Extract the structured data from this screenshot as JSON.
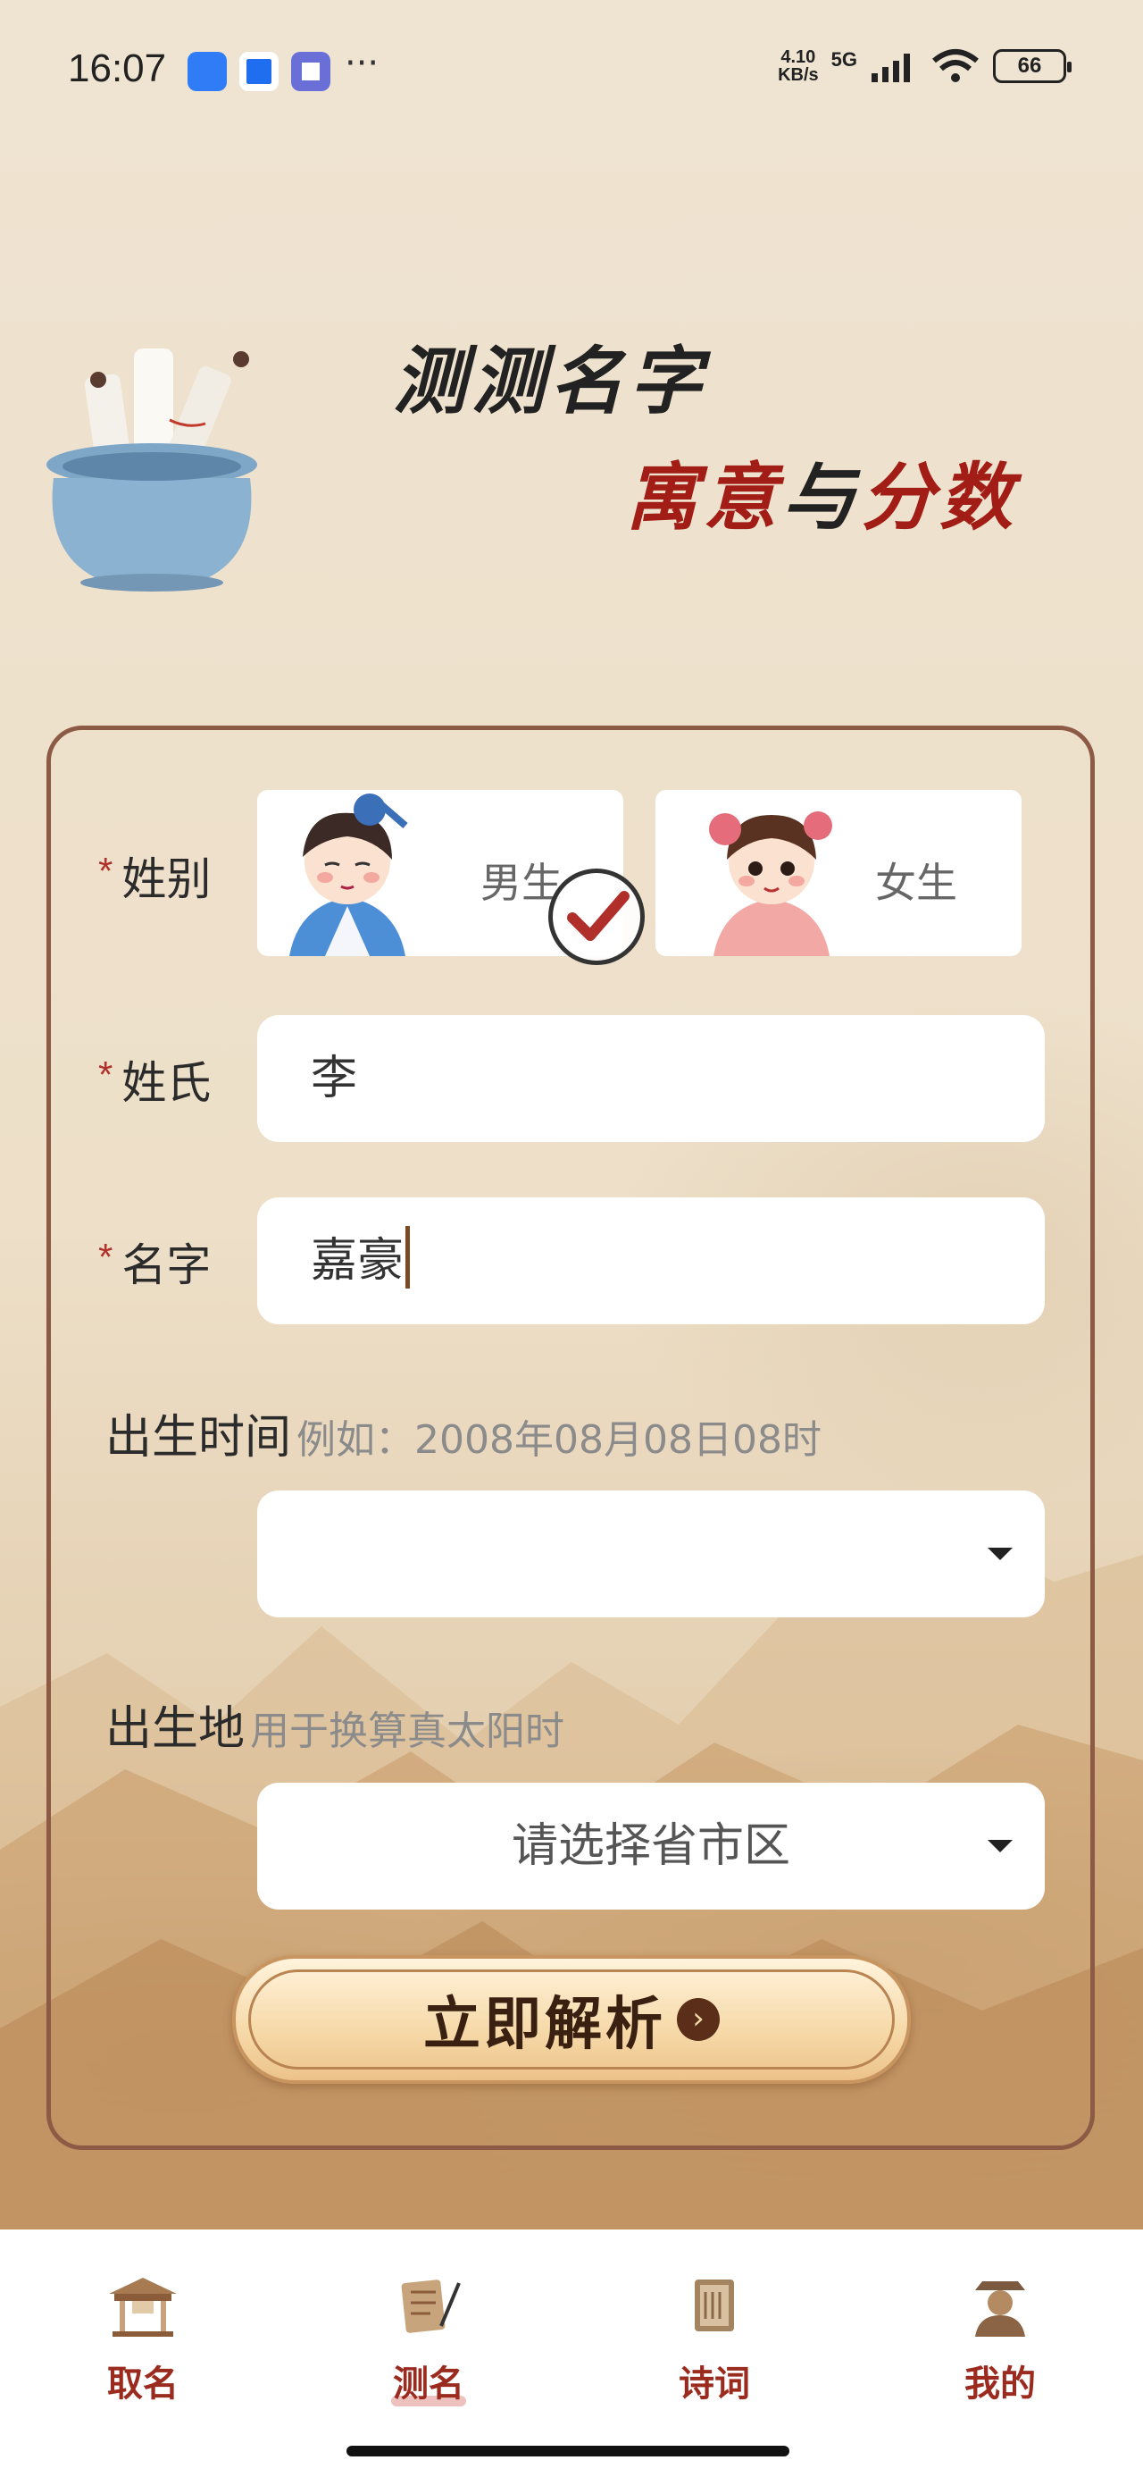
{
  "status_bar": {
    "time": "16:07",
    "net_speed_top": "4.10",
    "net_speed_bottom": "KB/s",
    "network": "5G",
    "battery": "66",
    "more": "···"
  },
  "header": {
    "title_line1": "测测名字",
    "title_line2_a": "寓意",
    "title_line2_b": "与",
    "title_line2_c": "分数"
  },
  "form": {
    "gender_label": "姓别",
    "gender_male": "男生",
    "gender_female": "女生",
    "gender_selected": "男生",
    "surname_label": "姓氏",
    "surname_value": "李",
    "name_label": "名字",
    "name_value": "嘉豪",
    "birth_time_label": "出生时间",
    "birth_time_hint": "例如：2008年08月08日08时",
    "birth_time_value": "",
    "birth_place_label": "出生地",
    "birth_place_hint": "用于换算真太阳时",
    "birth_place_placeholder": "请选择省市区",
    "required_mark": "*",
    "submit_label": "立即解析"
  },
  "tabs": [
    {
      "label": "取名",
      "icon": "pavilion-icon"
    },
    {
      "label": "测名",
      "icon": "scroll-brush-icon",
      "active": true
    },
    {
      "label": "诗词",
      "icon": "book-icon"
    },
    {
      "label": "我的",
      "icon": "scholar-icon"
    }
  ],
  "colors": {
    "accent": "#9a2b1e",
    "card_border": "#8c5a45",
    "title_red": "#a11d16"
  }
}
